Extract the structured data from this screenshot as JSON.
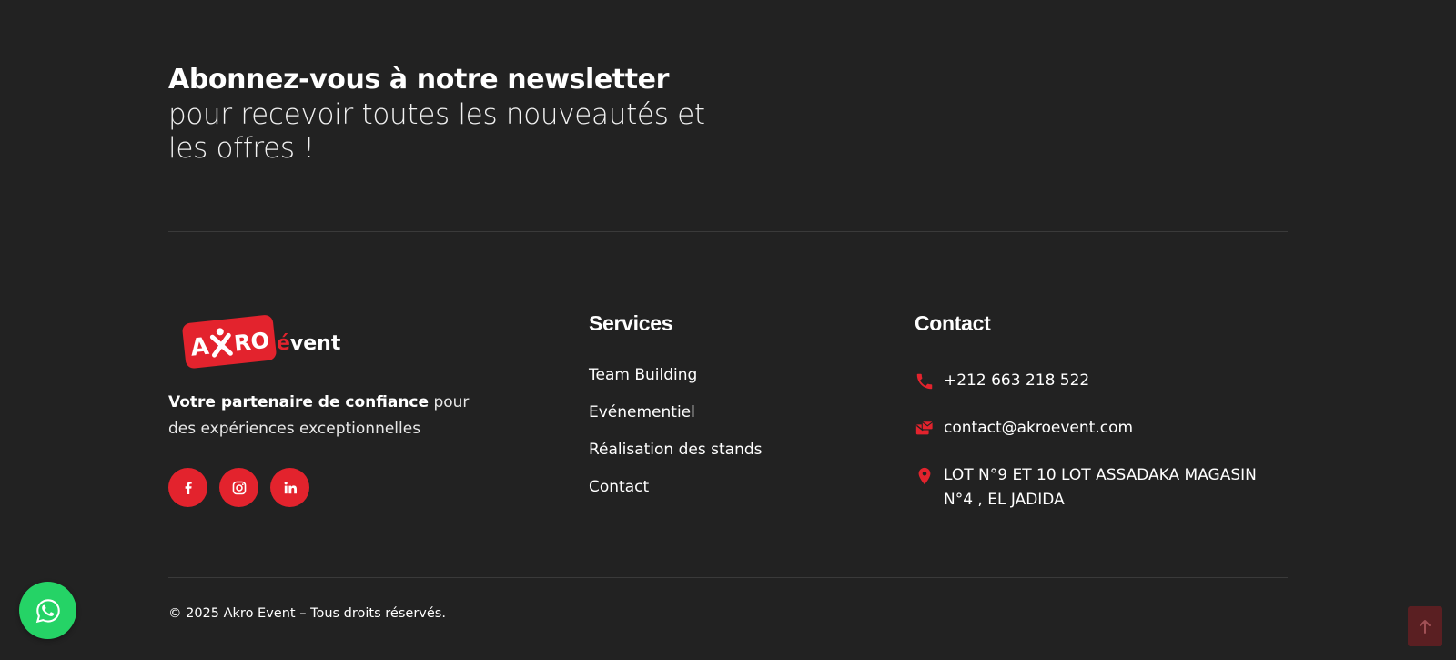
{
  "newsletter": {
    "title": "Abonnez-vous à notre newsletter",
    "subtitle": "pour recevoir toutes les nouveautés et les offres !"
  },
  "brand": {
    "logo_text_main": "AKRO",
    "logo_text_accent": "évent",
    "tagline_bold": "Votre partenaire de confiance",
    "tagline_rest": " pour des expériences exceptionnelles"
  },
  "social": [
    {
      "name": "facebook-icon"
    },
    {
      "name": "instagram-icon"
    },
    {
      "name": "linkedin-icon"
    }
  ],
  "services": {
    "title": "Services",
    "items": [
      "Team Building",
      "Evénementiel",
      "Réalisation des stands",
      "Contact"
    ]
  },
  "contact": {
    "title": "Contact",
    "phone": "+212 663 218 522",
    "email": "contact@akroevent.com",
    "address": "LOT N°9 ET 10 LOT ASSADAKA MAGASIN N°4 , EL JADIDA"
  },
  "footer": {
    "copyright": "© 2025 Akro Event – Tous droits réservés."
  },
  "colors": {
    "background": "#222222",
    "accent": "#e3232d",
    "whatsapp": "#25d366"
  }
}
